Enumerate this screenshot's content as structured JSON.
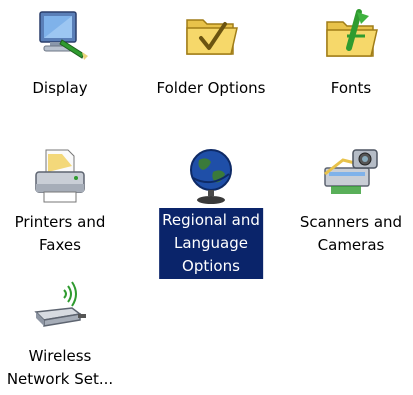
{
  "items": [
    {
      "label_lines": [
        "Display"
      ],
      "icon": "display-icon",
      "selected": false
    },
    {
      "label_lines": [
        "Folder Options"
      ],
      "icon": "folder-options-icon",
      "selected": false
    },
    {
      "label_lines": [
        "Fonts"
      ],
      "icon": "fonts-folder-icon",
      "selected": false
    },
    {
      "label_lines": [
        "Printers and",
        "Faxes"
      ],
      "icon": "printer-icon",
      "selected": false
    },
    {
      "label_lines": [
        "Regional and",
        "Language",
        "Options"
      ],
      "icon": "globe-icon",
      "selected": true
    },
    {
      "label_lines": [
        "Scanners and",
        "Cameras"
      ],
      "icon": "scanner-camera-icon",
      "selected": false
    },
    {
      "label_lines": [
        "Wireless",
        "Network Set..."
      ],
      "icon": "wireless-network-icon",
      "selected": false
    }
  ],
  "colors": {
    "selection_background": "#0a246a",
    "selection_text": "#ffffff"
  }
}
